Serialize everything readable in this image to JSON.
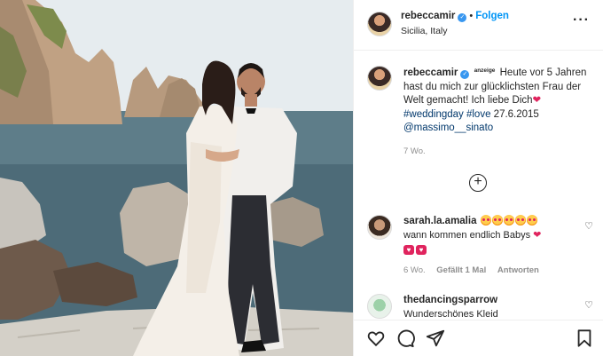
{
  "post": {
    "username": "rebeccamir",
    "follow_label": "Folgen",
    "location": "Sicilia, Italy",
    "caption": {
      "username": "rebeccamir",
      "badge": "anzeige",
      "text_line": "Heute vor 5 Jahren hast du mich zur glücklichsten Frau der Welt gemacht! Ich liebe Dich",
      "hashtags": "#weddingday #love",
      "date_text": "27.6.2015",
      "mention": "@massimo__sinato",
      "age": "7 Wo."
    }
  },
  "comments": [
    {
      "username": "sarah.la.amalia",
      "text": "wann kommen endlich Babys",
      "age": "6 Wo.",
      "likes": "Gefällt 1 Mal",
      "reply": "Antworten"
    },
    {
      "username": "thedancingsparrow",
      "text": "Wunderschönes Kleid"
    }
  ],
  "icons": {
    "verified": "verified-badge-icon",
    "more": "more-options-icon",
    "load_more": "plus-circle-icon",
    "like": "heart-icon",
    "comment": "comment-icon",
    "share": "share-icon",
    "save": "bookmark-icon"
  },
  "colors": {
    "accent": "#0095f6",
    "verified": "#3897f0",
    "heart": "#e0245e",
    "meta": "#8e8e8e"
  }
}
